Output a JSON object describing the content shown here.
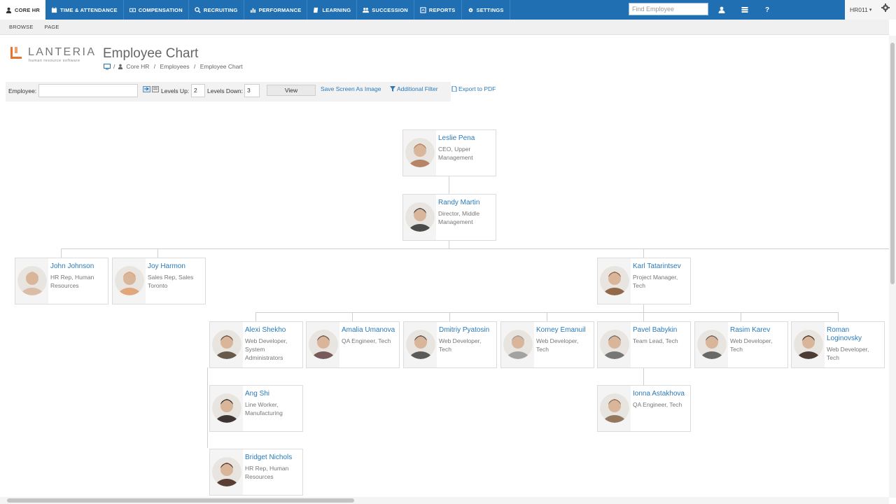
{
  "nav": {
    "items": [
      {
        "label": "CORE HR",
        "icon": "user-icon",
        "active": true
      },
      {
        "label": "TIME & ATTENDANCE",
        "icon": "calendar-icon"
      },
      {
        "label": "COMPENSATION",
        "icon": "money-icon"
      },
      {
        "label": "RECRUITING",
        "icon": "search-icon"
      },
      {
        "label": "PERFORMANCE",
        "icon": "bar-chart-icon"
      },
      {
        "label": "LEARNING",
        "icon": "book-icon"
      },
      {
        "label": "SUCCESSION",
        "icon": "users-icon"
      },
      {
        "label": "REPORTS",
        "icon": "report-icon"
      },
      {
        "label": "SETTINGS",
        "icon": "gear-icon"
      }
    ],
    "find_placeholder": "Find Employee",
    "user": "HR011"
  },
  "ribbon": {
    "tabs": [
      "BROWSE",
      "PAGE"
    ]
  },
  "header": {
    "logo_word": "LANTERIA",
    "logo_tagline": "human resource software",
    "title": "Employee Chart",
    "breadcrumb": [
      "Core HR",
      "Employees",
      "Employee Chart"
    ]
  },
  "filter": {
    "employee_label": "Employee:",
    "employee_value": "",
    "levels_up_label": "Levels Up:",
    "levels_up": "2",
    "levels_down_label": "Levels Down:",
    "levels_down": "3",
    "view_label": "View",
    "save_image": "Save Screen As Image",
    "additional_filter": "Additional Filter",
    "export_pdf": "Export to PDF"
  },
  "employees": [
    {
      "name": "Leslie Pena",
      "title_lines": [
        "CEO, Upper",
        "Management"
      ],
      "avatar_color": "#b07a5a"
    },
    {
      "name": "Randy Martin",
      "title_lines": [
        "Director, Middle",
        "Management"
      ],
      "avatar_color": "#3a3a3a"
    },
    {
      "name": "John Johnson",
      "title_lines": [
        "HR Rep, Human",
        "Resources"
      ],
      "avatar_color": "#d9b8a0"
    },
    {
      "name": "Joy Harmon",
      "title_lines": [
        "Sales Rep, Sales",
        "Toronto"
      ],
      "avatar_color": "#e0a070"
    },
    {
      "name": "Karl Tatarintsev",
      "title_lines": [
        "Project Manager,",
        "Tech"
      ],
      "avatar_color": "#8a5a3a"
    },
    {
      "name": "Alexi Shekho",
      "title_lines": [
        "Web Developer,",
        "System",
        "Administrators"
      ],
      "avatar_color": "#5a4a3a"
    },
    {
      "name": "Amalia Umanova",
      "title_lines": [
        "QA Engineer, Tech"
      ],
      "avatar_color": "#6a4a4a"
    },
    {
      "name": "Dmitriy Pyatosin",
      "title_lines": [
        "Web Developer,",
        "Tech"
      ],
      "avatar_color": "#4a4a4a"
    },
    {
      "name": "Korney Emanuil",
      "title_lines": [
        "Web Developer,",
        "Tech"
      ],
      "avatar_color": "#9a9a9a"
    },
    {
      "name": "Pavel Babykin",
      "title_lines": [
        "Team Lead, Tech"
      ],
      "avatar_color": "#6a6a6a"
    },
    {
      "name": "Rasim Karev",
      "title_lines": [
        "Web Developer,",
        "Tech"
      ],
      "avatar_color": "#5a5a5a"
    },
    {
      "name": "Roman Loginovsky",
      "name_lines": [
        "Roman",
        "Loginovsky"
      ],
      "title_lines": [
        "Web Developer,",
        "Tech"
      ],
      "avatar_color": "#3a2a22"
    },
    {
      "name": "Ang Shi",
      "title_lines": [
        "Line Worker,",
        "Manufacturing"
      ],
      "avatar_color": "#2a2020"
    },
    {
      "name": "Ionna Astakhova",
      "title_lines": [
        "QA Engineer, Tech"
      ],
      "avatar_color": "#8a6a50"
    },
    {
      "name": "Bridget Nichols",
      "title_lines": [
        "HR Rep, Human",
        "Resources"
      ],
      "avatar_color": "#4a2a22"
    }
  ]
}
